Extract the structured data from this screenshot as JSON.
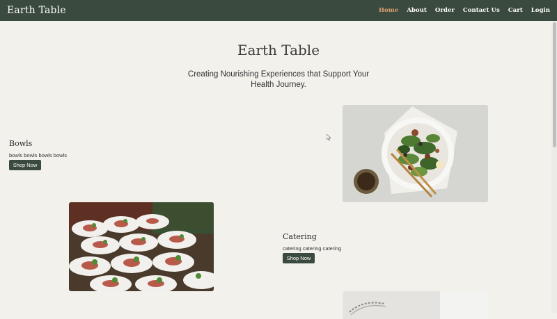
{
  "nav": {
    "brand": "Earth Table",
    "links": [
      "Home",
      "About",
      "Order",
      "Contact Us",
      "Cart",
      "Login"
    ]
  },
  "hero": {
    "title": "Earth Table",
    "subtitle": "Creating Nourishing Experiences that Support Your Health Journey."
  },
  "sections": [
    {
      "title": "Bowls",
      "description": "bowls bowls bowls bowls",
      "button": "Shop Now",
      "image": "salad-bowl-photo"
    },
    {
      "title": "Catering",
      "description": "catering catering catering",
      "button": "Shop Now",
      "image": "catering-plates-photo"
    }
  ],
  "colors": {
    "nav_bg": "#3b4a3e",
    "accent": "#d8a06d",
    "page_bg": "#f3f1ec"
  }
}
